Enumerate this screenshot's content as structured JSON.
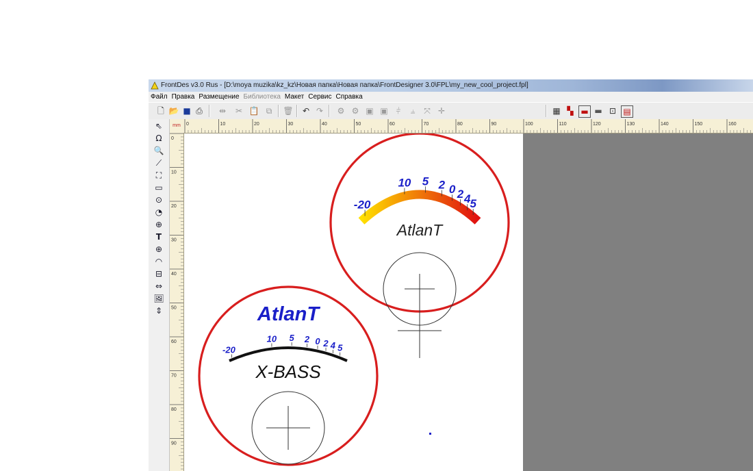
{
  "window": {
    "title": "FrontDes v3.0 Rus - [D:\\moya muzika\\kz_kz\\Новая папка\\Новая папка\\FrontDesigner 3.0\\FPL\\my_new_cool_project.fpl]"
  },
  "menu": [
    {
      "label": "Файл",
      "enabled": true
    },
    {
      "label": "Правка",
      "enabled": true
    },
    {
      "label": "Размещение",
      "enabled": true
    },
    {
      "label": "Библиотека",
      "enabled": false
    },
    {
      "label": "Макет",
      "enabled": true
    },
    {
      "label": "Сервис",
      "enabled": true
    },
    {
      "label": "Справка",
      "enabled": true
    }
  ],
  "ruler": {
    "unit": "mm",
    "h_labels": [
      "0",
      "10",
      "20",
      "30",
      "40",
      "50",
      "60",
      "70",
      "80",
      "90",
      "100",
      "110",
      "120",
      "130",
      "140",
      "150",
      "160"
    ],
    "v_labels": [
      "0",
      "10",
      "20",
      "30",
      "40",
      "50",
      "60",
      "70",
      "80",
      "90"
    ]
  },
  "design": {
    "meter1": {
      "scale_labels": [
        "-20",
        "10",
        "5",
        "2",
        "0",
        "2",
        "4",
        "5"
      ],
      "brand": "AtlanT",
      "colors": {
        "ring": "#d81e1e",
        "scale_labels": "#1a1fc8",
        "gradient_start": "#ffe000",
        "gradient_end": "#e01010"
      }
    },
    "meter2": {
      "brand": "AtlanT",
      "scale_labels": [
        "-20",
        "10",
        "5",
        "2",
        "0",
        "2",
        "4",
        "5"
      ],
      "model": "X-BASS",
      "colors": {
        "ring": "#d81e1e",
        "brand": "#1a1fc8",
        "scale_labels": "#1a1fc8",
        "arc": "#111111"
      }
    }
  }
}
